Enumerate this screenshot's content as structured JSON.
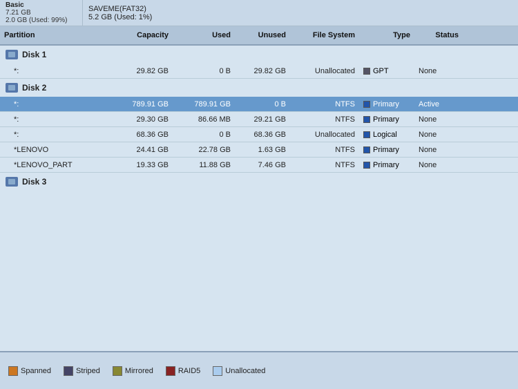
{
  "topBar": {
    "disk1": {
      "type": "Basic",
      "size": "7.21 GB",
      "label": "2.0 GB (Used: 99%)"
    },
    "saveme": {
      "label": "SAVEME(FAT32)",
      "size": "5.2 GB (Used: 1%)"
    }
  },
  "tableHeaders": {
    "partition": "Partition",
    "capacity": "Capacity",
    "used": "Used",
    "unused": "Unused",
    "filesystem": "File System",
    "type": "Type",
    "status": "Status"
  },
  "disks": [
    {
      "name": "Disk 1",
      "partitions": [
        {
          "name": "*:",
          "capacity": "29.82 GB",
          "used": "0 B",
          "unused": "29.82 GB",
          "filesystem": "Unallocated",
          "typeColor": "dark",
          "typeLabel": "GPT",
          "status": "None",
          "selected": false
        }
      ]
    },
    {
      "name": "Disk 2",
      "partitions": [
        {
          "name": "*:",
          "capacity": "789.91 GB",
          "used": "789.91 GB",
          "unused": "0 B",
          "filesystem": "NTFS",
          "typeColor": "blue",
          "typeLabel": "Primary",
          "status": "Active",
          "selected": true
        },
        {
          "name": "*:",
          "capacity": "29.30 GB",
          "used": "86.66 MB",
          "unused": "29.21 GB",
          "filesystem": "NTFS",
          "typeColor": "blue",
          "typeLabel": "Primary",
          "status": "None",
          "selected": false
        },
        {
          "name": "*:",
          "capacity": "68.36 GB",
          "used": "0 B",
          "unused": "68.36 GB",
          "filesystem": "Unallocated",
          "typeColor": "blue",
          "typeLabel": "Logical",
          "status": "None",
          "selected": false
        },
        {
          "name": "*LENOVO",
          "capacity": "24.41 GB",
          "used": "22.78 GB",
          "unused": "1.63 GB",
          "filesystem": "NTFS",
          "typeColor": "blue",
          "typeLabel": "Primary",
          "status": "None",
          "selected": false
        },
        {
          "name": "*LENOVO_PART",
          "capacity": "19.33 GB",
          "used": "11.88 GB",
          "unused": "7.46 GB",
          "filesystem": "NTFS",
          "typeColor": "blue",
          "typeLabel": "Primary",
          "status": "None",
          "selected": false
        }
      ]
    },
    {
      "name": "Disk 3",
      "partitions": []
    }
  ],
  "legend": [
    {
      "label": "Spanned",
      "color": "orange"
    },
    {
      "label": "Striped",
      "color": "striped-dark"
    },
    {
      "label": "Mirrored",
      "color": "olive"
    },
    {
      "label": "RAID5",
      "color": "red-dark"
    },
    {
      "label": "Unallocated",
      "color": "light-blue"
    }
  ]
}
